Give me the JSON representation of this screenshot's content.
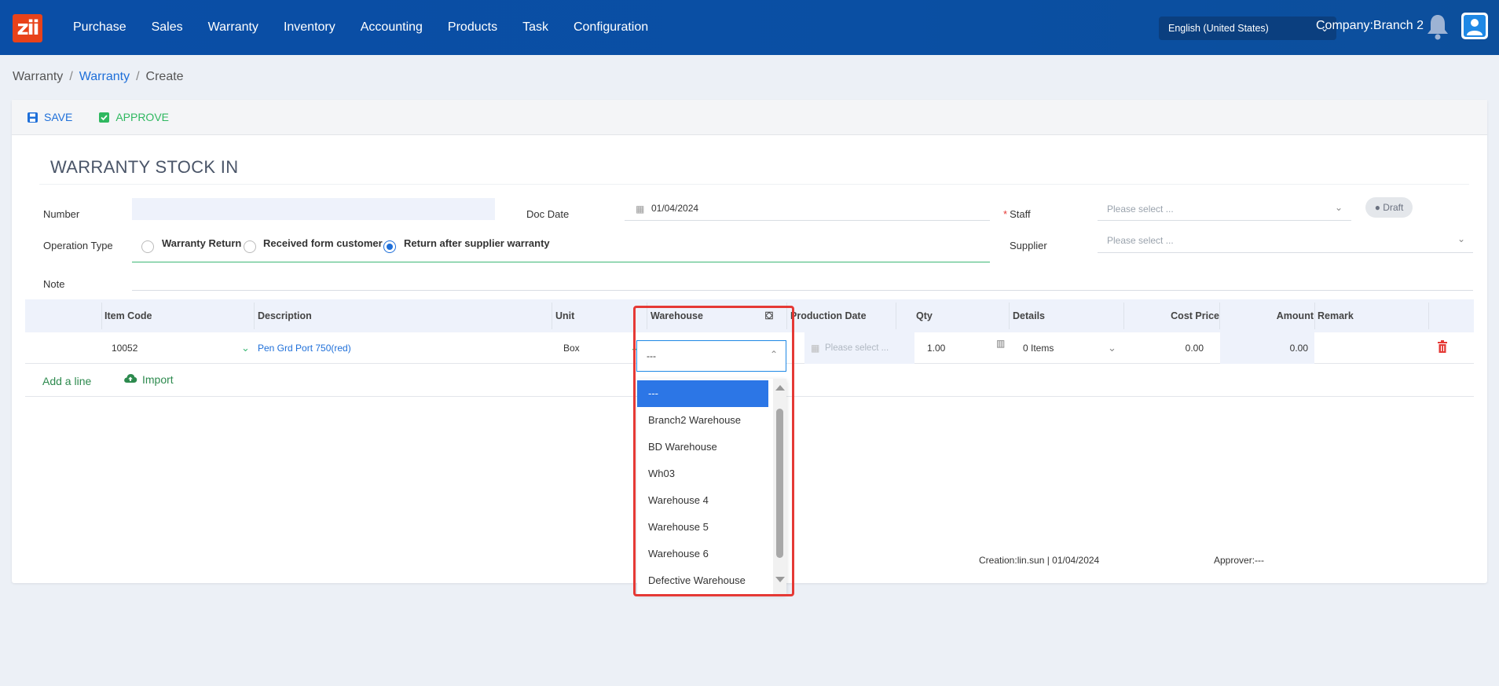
{
  "nav": {
    "logo_text": "zii",
    "items": [
      "Purchase",
      "Sales",
      "Warranty",
      "Inventory",
      "Accounting",
      "Products",
      "Task",
      "Configuration"
    ],
    "language": "English (United States)",
    "company": "Company:Branch 2"
  },
  "breadcrumb": {
    "root": "Warranty",
    "link": "Warranty",
    "current": "Create"
  },
  "toolbar": {
    "save_label": "SAVE",
    "approve_label": "APPROVE"
  },
  "form": {
    "title": "WARRANTY STOCK IN",
    "number_label": "Number",
    "number_value": "",
    "doc_date_label": "Doc Date",
    "doc_date_value": "01/04/2024",
    "staff_label": "Staff",
    "staff_required_mark": "*",
    "staff_placeholder": "Please select ...",
    "status_badge": "● Draft",
    "operation_type_label": "Operation Type",
    "operation_options": [
      "Warranty Return",
      "Received form customer",
      "Return after supplier warranty"
    ],
    "operation_selected": "Return after supplier warranty",
    "supplier_label": "Supplier",
    "supplier_placeholder": "Please select ...",
    "note_label": "Note",
    "note_value": ""
  },
  "table": {
    "headers": [
      "Item Code",
      "Description",
      "Unit",
      "Warehouse",
      "Production Date",
      "Qty",
      "Details",
      "Cost Price",
      "Amount",
      "Remark"
    ],
    "rows": [
      {
        "item_code": "10052",
        "description": "Pen Grd Port 750(red)",
        "unit": "Box",
        "warehouse": "---",
        "production_date_placeholder": "Please select ...",
        "qty": "1.00",
        "details": "0 Items",
        "cost_price": "0.00",
        "amount": "0.00",
        "remark": ""
      }
    ],
    "add_line_label": "Add a line",
    "import_label": "Import"
  },
  "warehouse_dropdown": {
    "options": [
      "---",
      "Branch2 Warehouse",
      "BD Warehouse",
      "Wh03",
      "Warehouse 4",
      "Warehouse 5",
      "Warehouse 6",
      "Defective Warehouse"
    ],
    "selected": "---"
  },
  "footer": {
    "creation": "Creation:lin.sun | 01/04/2024",
    "approver": "Approver:---"
  },
  "colors": {
    "nav_bg": "#0a4ea6",
    "accent": "#1e6fd9",
    "approve": "#2fb860",
    "delete": "#e53935",
    "highlight": "#e53935"
  }
}
